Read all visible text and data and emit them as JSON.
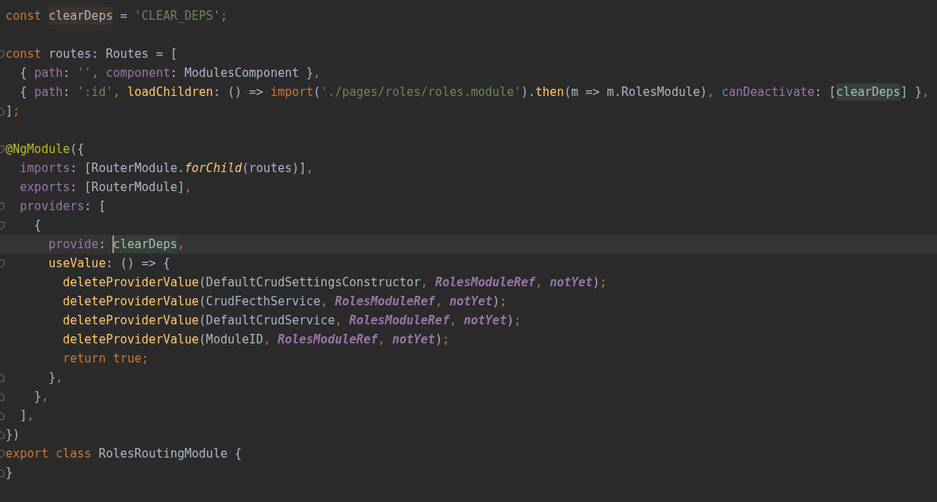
{
  "editor": {
    "lines": [
      {
        "kind": "plain",
        "tokens": [
          {
            "text": "const ",
            "kind": "keyword"
          },
          {
            "text": "clearDeps",
            "kind": "plain",
            "color": "#40332b"
          },
          {
            "text": " = ",
            "kind": "plain"
          },
          {
            "text": "'CLEAR_DEPS'",
            "kind": "string"
          },
          {
            "text": ";",
            "kind": "keyword"
          }
        ]
      },
      {
        "kind": "plain"
      },
      {
        "kind": "opener",
        "tokens": [
          {
            "text": "const ",
            "kind": "keyword"
          },
          {
            "text": "routes: Routes = [",
            "kind": "plain"
          }
        ]
      },
      {
        "kind": "plain",
        "tokens": [
          {
            "text": "  { ",
            "kind": "plain"
          },
          {
            "text": "path",
            "kind": "property"
          },
          {
            "text": ": ",
            "kind": "plain"
          },
          {
            "text": "''",
            "kind": "string"
          },
          {
            "text": ", ",
            "kind": "keyword"
          },
          {
            "text": "component",
            "kind": "property"
          },
          {
            "text": ": ModulesComponent }",
            "kind": "plain"
          },
          {
            "text": ",",
            "kind": "keyword"
          }
        ]
      },
      {
        "kind": "plain",
        "tokens": [
          {
            "text": "  { ",
            "kind": "plain"
          },
          {
            "text": "path",
            "kind": "property"
          },
          {
            "text": ": ",
            "kind": "plain"
          },
          {
            "text": "':id'",
            "kind": "string"
          },
          {
            "text": ", ",
            "kind": "keyword"
          },
          {
            "text": "loadChildren",
            "kind": "function"
          },
          {
            "text": ": () => ",
            "kind": "plain"
          },
          {
            "text": "import",
            "kind": "keyword"
          },
          {
            "text": "(",
            "kind": "plain"
          },
          {
            "text": "'./pages/roles/roles.module'",
            "kind": "string"
          },
          {
            "text": ").",
            "kind": "plain"
          },
          {
            "text": "then",
            "kind": "function"
          },
          {
            "text": "(m => m.RolesModule)",
            "kind": "plain"
          },
          {
            "text": ", ",
            "kind": "keyword"
          },
          {
            "text": "canDeactivate",
            "kind": "property"
          },
          {
            "text": ": [",
            "kind": "plain"
          },
          {
            "text": "clearDeps",
            "kind": "plain",
            "color": "#344134"
          },
          {
            "text": "] }",
            "kind": "plain"
          },
          {
            "text": ",",
            "kind": "keyword"
          }
        ]
      },
      {
        "kind": "closer",
        "tokens": [
          {
            "text": "]",
            "kind": "plain"
          },
          {
            "text": ";",
            "kind": "keyword"
          }
        ]
      },
      {
        "kind": "plain"
      },
      {
        "kind": "opener",
        "tokens": [
          {
            "text": "@NgModule",
            "kind": "decorator"
          },
          {
            "text": "({",
            "kind": "plain"
          }
        ]
      },
      {
        "kind": "plain",
        "tokens": [
          {
            "text": "  imports",
            "kind": "property"
          },
          {
            "text": ": [RouterModule.",
            "kind": "plain"
          },
          {
            "text": "forChild",
            "kind": "method"
          },
          {
            "text": "(routes)]",
            "kind": "plain"
          },
          {
            "text": ",",
            "kind": "keyword"
          }
        ]
      },
      {
        "kind": "plain",
        "tokens": [
          {
            "text": "  exports",
            "kind": "property"
          },
          {
            "text": ": [RouterModule]",
            "kind": "plain"
          },
          {
            "text": ",",
            "kind": "keyword"
          }
        ]
      },
      {
        "kind": "opener",
        "tokens": [
          {
            "text": "  providers",
            "kind": "property"
          },
          {
            "text": ": [",
            "kind": "plain"
          }
        ]
      },
      {
        "kind": "opener",
        "tokens": [
          {
            "text": "    {",
            "kind": "plain"
          }
        ]
      },
      {
        "kind": "plain",
        "current": true,
        "tokens": [
          {
            "text": "      provide",
            "kind": "property"
          },
          {
            "text": ": ",
            "kind": "plain"
          },
          {
            "text": "clearDeps",
            "kind": "plain",
            "color": "#344134",
            "caret": true
          },
          {
            "text": ",",
            "kind": "keyword"
          }
        ]
      },
      {
        "kind": "opener",
        "tokens": [
          {
            "text": "      useValue",
            "kind": "function"
          },
          {
            "text": ": () => {",
            "kind": "plain"
          }
        ]
      },
      {
        "kind": "plain",
        "tokens": [
          {
            "text": "        deleteProviderValue",
            "kind": "function"
          },
          {
            "text": "(DefaultCrudSettingsConstructor",
            "kind": "plain"
          },
          {
            "text": ", ",
            "kind": "keyword"
          },
          {
            "text": "RolesModuleRef",
            "kind": "field"
          },
          {
            "text": ", ",
            "kind": "keyword"
          },
          {
            "text": "notYet",
            "kind": "field"
          },
          {
            "text": ")",
            "kind": "plain"
          },
          {
            "text": ";",
            "kind": "keyword"
          }
        ]
      },
      {
        "kind": "plain",
        "tokens": [
          {
            "text": "        deleteProviderValue",
            "kind": "function"
          },
          {
            "text": "(CrudFecthService",
            "kind": "plain"
          },
          {
            "text": ", ",
            "kind": "keyword"
          },
          {
            "text": "RolesModuleRef",
            "kind": "field"
          },
          {
            "text": ", ",
            "kind": "keyword"
          },
          {
            "text": "notYet",
            "kind": "field"
          },
          {
            "text": ")",
            "kind": "plain"
          },
          {
            "text": ";",
            "kind": "keyword"
          }
        ]
      },
      {
        "kind": "plain",
        "tokens": [
          {
            "text": "        deleteProviderValue",
            "kind": "function"
          },
          {
            "text": "(DefaultCrudService",
            "kind": "plain"
          },
          {
            "text": ", ",
            "kind": "keyword"
          },
          {
            "text": "RolesModuleRef",
            "kind": "field"
          },
          {
            "text": ", ",
            "kind": "keyword"
          },
          {
            "text": "notYet",
            "kind": "field"
          },
          {
            "text": ")",
            "kind": "plain"
          },
          {
            "text": ";",
            "kind": "keyword"
          }
        ]
      },
      {
        "kind": "plain",
        "tokens": [
          {
            "text": "        deleteProviderValue",
            "kind": "function"
          },
          {
            "text": "(ModuleID",
            "kind": "plain"
          },
          {
            "text": ", ",
            "kind": "keyword"
          },
          {
            "text": "RolesModuleRef",
            "kind": "field"
          },
          {
            "text": ", ",
            "kind": "keyword"
          },
          {
            "text": "notYet",
            "kind": "field"
          },
          {
            "text": ")",
            "kind": "plain"
          },
          {
            "text": ";",
            "kind": "keyword"
          }
        ]
      },
      {
        "kind": "plain",
        "tokens": [
          {
            "text": "        return true;",
            "kind": "keyword"
          }
        ]
      },
      {
        "kind": "closer",
        "tokens": [
          {
            "text": "      }",
            "kind": "plain"
          },
          {
            "text": ",",
            "kind": "keyword"
          }
        ]
      },
      {
        "kind": "closer",
        "tokens": [
          {
            "text": "    }",
            "kind": "plain"
          },
          {
            "text": ",",
            "kind": "keyword"
          }
        ]
      },
      {
        "kind": "closer",
        "tokens": [
          {
            "text": "  ]",
            "kind": "plain"
          },
          {
            "text": ",",
            "kind": "keyword"
          }
        ]
      },
      {
        "kind": "closer",
        "tokens": [
          {
            "text": "})",
            "kind": "plain"
          }
        ]
      },
      {
        "kind": "opener",
        "tokens": [
          {
            "text": "export class ",
            "kind": "keyword"
          },
          {
            "text": "RolesRoutingModule {",
            "kind": "plain"
          }
        ]
      },
      {
        "kind": "closer",
        "tokens": [
          {
            "text": "}",
            "kind": "plain"
          }
        ]
      }
    ]
  }
}
